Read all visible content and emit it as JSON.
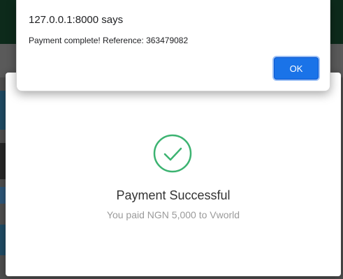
{
  "alert": {
    "title": "127.0.0.1:8000 says",
    "message": "Payment complete! Reference: 363479082",
    "ok_label": "OK"
  },
  "modal": {
    "icon": "check-circle-icon",
    "title": "Payment Successful",
    "subtitle": "You paid NGN 5,000 to Vworld"
  },
  "colors": {
    "accent": "#1a73e8",
    "success": "#3cb371"
  }
}
